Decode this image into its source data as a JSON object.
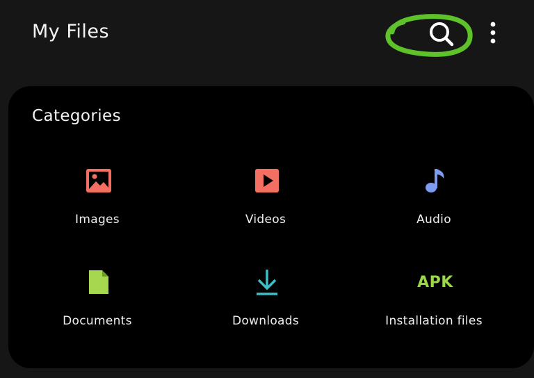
{
  "header": {
    "title": "My Files",
    "search_icon": "search-icon",
    "more_icon": "more-vertical-icon",
    "annotation_color": "#5ec22a"
  },
  "categories_section": {
    "title": "Categories",
    "items": [
      {
        "label": "Images",
        "icon": "image-icon",
        "color": "#f26f61"
      },
      {
        "label": "Videos",
        "icon": "video-play-icon",
        "color": "#f26f61"
      },
      {
        "label": "Audio",
        "icon": "music-note-icon",
        "color": "#7d9cf0"
      },
      {
        "label": "Documents",
        "icon": "document-icon",
        "color": "#a6d84f"
      },
      {
        "label": "Downloads",
        "icon": "download-icon",
        "color": "#3cc0c8"
      },
      {
        "label": "Installation files",
        "icon": "apk-icon",
        "icon_text": "APK",
        "color": "#9ad84a"
      }
    ]
  }
}
